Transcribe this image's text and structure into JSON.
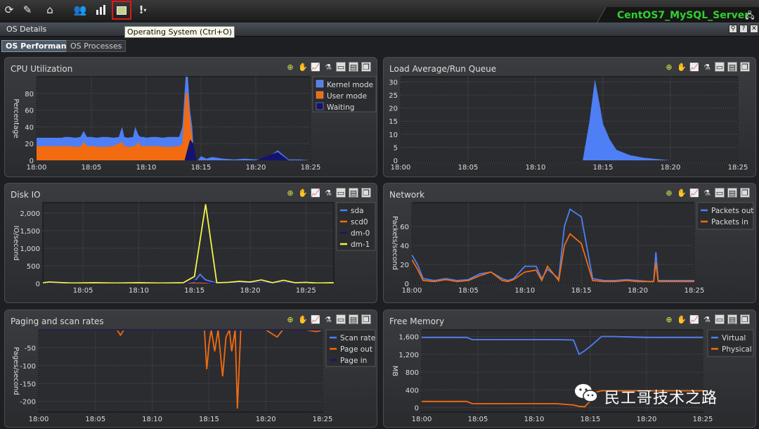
{
  "app": {
    "server_name": "CentOS7_MySQL_Server",
    "tooltip": "Operating System (Ctrl+O)",
    "window_title": "OS Details",
    "tabs": [
      {
        "label": "OS Performance",
        "active": true
      },
      {
        "label": "OS Processes",
        "active": false
      }
    ],
    "toolbar_icons": [
      "refresh-icon",
      "settings-icon",
      "home-icon",
      "users-icon",
      "bar-chart-icon",
      "operating-system-icon",
      "alert-icon"
    ]
  },
  "watermark": "民工哥技术之路",
  "colors": {
    "blue": "#4f7ff5",
    "orange": "#f26b10",
    "navy": "#14146e",
    "yellow": "#f3f34a",
    "plot_bg": "#2b2c2f",
    "grid": "#55575c"
  },
  "chart_data": [
    {
      "id": "cpu",
      "title": "CPU Utilization",
      "type": "area",
      "ylabel": "Percentage",
      "ylim": [
        0,
        100
      ],
      "yticks": [
        "0",
        "20",
        "40",
        "60",
        "80"
      ],
      "yticks_values": [
        0,
        20,
        40,
        60,
        80
      ],
      "x_labels": [
        "18:00",
        "18:05",
        "18:10",
        "18:15",
        "18:20",
        "18:25"
      ],
      "x_range": [
        0,
        25
      ],
      "legend_placement": "top-right",
      "series": [
        {
          "name": "Kernel mode",
          "color": "#4f7ff5",
          "x": [
            0,
            2,
            2.3,
            2.6,
            3,
            3.5,
            4,
            4.3,
            4.6,
            5,
            5.5,
            6,
            6.5,
            7,
            7.5,
            7.8,
            8,
            8.3,
            8.8,
            9,
            9.3,
            9.5,
            9.8,
            10,
            10.5,
            11,
            11.5,
            12,
            12.5,
            13,
            13.3,
            13.6,
            13.8,
            14,
            14.2,
            14.4,
            14.7,
            15,
            15.5,
            16,
            17,
            18,
            19,
            20,
            21,
            22,
            23,
            24,
            25
          ],
          "values": [
            27,
            27,
            27,
            28,
            28,
            27,
            28,
            35,
            28,
            28,
            27,
            28,
            28,
            27,
            28,
            40,
            28,
            27,
            28,
            40,
            30,
            28,
            28,
            27,
            28,
            28,
            27,
            28,
            28,
            28,
            40,
            100,
            100,
            60,
            40,
            0,
            0,
            5,
            2,
            4,
            2,
            1,
            2,
            1,
            3,
            12,
            1,
            1,
            0
          ]
        },
        {
          "name": "User mode",
          "color": "#f26b10",
          "x": [
            0,
            2,
            3,
            4,
            4.3,
            4.6,
            5,
            6,
            7,
            7.8,
            8,
            8.5,
            9,
            9.3,
            9.5,
            10,
            11,
            12,
            13,
            13.3,
            13.6,
            13.8,
            14,
            14.2,
            14.4,
            15,
            25
          ],
          "values": [
            17,
            17,
            17,
            16,
            22,
            17,
            17,
            16,
            17,
            22,
            17,
            16,
            17,
            22,
            17,
            17,
            17,
            16,
            17,
            20,
            80,
            80,
            50,
            25,
            0,
            0,
            0
          ]
        },
        {
          "name": "Waiting",
          "color": "#14146e",
          "x": [
            0,
            13.5,
            14,
            14.3,
            14.6,
            15,
            20,
            22,
            23,
            25
          ],
          "values": [
            0,
            0,
            25,
            20,
            0,
            0,
            0,
            10,
            0,
            0
          ]
        }
      ]
    },
    {
      "id": "load",
      "title": "Load Average/Run Queue",
      "type": "area",
      "ylabel": "",
      "ylim": [
        0,
        32
      ],
      "yticks": [
        "0",
        "5",
        "10",
        "15",
        "20",
        "25",
        "30"
      ],
      "yticks_values": [
        0,
        5,
        10,
        15,
        20,
        25,
        30
      ],
      "x_labels": [
        "18:00",
        "18:05",
        "18:10",
        "18:15",
        "18:20",
        "18:25"
      ],
      "x_range": [
        0,
        25
      ],
      "series": [
        {
          "name": "",
          "color": "#4f7ff5",
          "x": [
            0,
            13.5,
            14,
            14.4,
            14.8,
            15,
            15.5,
            16,
            17,
            18,
            19,
            20,
            25
          ],
          "values": [
            0,
            0,
            15,
            31,
            20,
            14,
            8,
            4,
            2,
            1,
            0.5,
            0,
            0
          ]
        }
      ]
    },
    {
      "id": "disk",
      "title": "Disk IO",
      "type": "line",
      "ylabel": "IO/second",
      "ylim": [
        0,
        2300
      ],
      "yticks": [
        "0",
        "500",
        "1,000",
        "1,500",
        "2,000"
      ],
      "yticks_values": [
        0,
        500,
        1000,
        1500,
        2000
      ],
      "x_labels": [
        "18:05",
        "18:10",
        "18:15",
        "18:20",
        "18:25"
      ],
      "x_labels_values": [
        5,
        10,
        15,
        20,
        25
      ],
      "x_range": [
        1.4,
        27.5
      ],
      "legend_placement": "top-right",
      "series": [
        {
          "name": "sda",
          "color": "#4f7ff5",
          "x": [
            1.4,
            14,
            15,
            15.5,
            16,
            17,
            27.5
          ],
          "values": [
            10,
            10,
            50,
            260,
            100,
            10,
            10
          ]
        },
        {
          "name": "scd0",
          "color": "#f26b10",
          "x": [
            1.4,
            27.5
          ],
          "values": [
            0,
            0
          ]
        },
        {
          "name": "dm-0",
          "color": "#14146e",
          "x": [
            1.4,
            14,
            15.5,
            16,
            17,
            27.5
          ],
          "values": [
            0,
            0,
            100,
            40,
            0,
            0
          ]
        },
        {
          "name": "dm-1",
          "color": "#f3f34a",
          "x": [
            1.4,
            2,
            4,
            6,
            8,
            10,
            12,
            14,
            15,
            16,
            17,
            18,
            19,
            20,
            21,
            22,
            23,
            24,
            25,
            26,
            27.5
          ],
          "values": [
            20,
            40,
            10,
            20,
            10,
            20,
            10,
            20,
            200,
            2250,
            20,
            30,
            60,
            40,
            100,
            20,
            90,
            20,
            30,
            10,
            20
          ]
        }
      ]
    },
    {
      "id": "network",
      "title": "Network",
      "type": "line",
      "ylabel": "Packets/second",
      "ylim": [
        0,
        85
      ],
      "yticks": [
        "0",
        "20",
        "40",
        "60"
      ],
      "yticks_values": [
        0,
        20,
        40,
        60
      ],
      "x_labels": [
        "18:00",
        "18:05",
        "18:10",
        "18:15",
        "18:20",
        "18:25"
      ],
      "x_range": [
        0,
        25
      ],
      "legend_placement": "top-right",
      "series": [
        {
          "name": "Packets out",
          "color": "#4f7ff5",
          "x": [
            0,
            0.5,
            1,
            2,
            3,
            4,
            5,
            6,
            7,
            8,
            8.5,
            9,
            10,
            11,
            11.5,
            12,
            13,
            13.5,
            14,
            15,
            16,
            17,
            18,
            19,
            20,
            21,
            21.4,
            21.6,
            21.8,
            22,
            23,
            24,
            25
          ],
          "values": [
            30,
            20,
            5,
            3,
            5,
            3,
            4,
            10,
            12,
            5,
            3,
            5,
            18,
            18,
            5,
            15,
            5,
            60,
            78,
            70,
            5,
            3,
            3,
            4,
            3,
            2,
            2,
            33,
            3,
            3,
            3,
            3,
            3
          ]
        },
        {
          "name": "Packets in",
          "color": "#f26b10",
          "x": [
            0,
            0.5,
            1,
            2,
            3,
            4,
            5,
            6,
            7,
            8,
            8.5,
            9,
            10,
            11,
            11.5,
            12,
            13,
            13.5,
            14,
            15,
            16,
            17,
            18,
            19,
            20,
            21,
            21.4,
            21.6,
            21.8,
            22,
            23,
            24,
            25
          ],
          "values": [
            25,
            15,
            3,
            2,
            4,
            2,
            3,
            8,
            12,
            3,
            2,
            4,
            12,
            14,
            3,
            18,
            3,
            40,
            52,
            42,
            3,
            2,
            2,
            3,
            2,
            2,
            2,
            22,
            2,
            2,
            2,
            2,
            2
          ]
        }
      ]
    },
    {
      "id": "paging",
      "title": "Paging and scan rates",
      "type": "line",
      "ylabel": "Pages/second",
      "ylim": [
        -230,
        0
      ],
      "yticks": [
        "-50",
        "-100",
        "-150",
        "-200"
      ],
      "yticks_values": [
        -50,
        -100,
        -150,
        -200
      ],
      "x_labels": [
        "18:00",
        "18:05",
        "18:10",
        "18:15",
        "18:20",
        "18:25"
      ],
      "x_range": [
        0,
        25
      ],
      "legend_placement": "top-right",
      "series": [
        {
          "name": "Scan rate",
          "color": "#4f7ff5",
          "x": [
            0,
            25
          ],
          "values": [
            0,
            0
          ]
        },
        {
          "name": "Page out",
          "color": "#f26b10",
          "x": [
            0,
            6.9,
            7.2,
            7.5,
            8,
            14.6,
            14.8,
            15,
            15.2,
            15.5,
            15.8,
            16.2,
            16.5,
            16.8,
            17,
            17.3,
            17.5,
            17.8,
            18,
            20,
            20.5,
            21,
            21.5,
            22,
            23.5,
            24.5,
            25
          ],
          "values": [
            0,
            0,
            -15,
            0,
            0,
            0,
            -110,
            -40,
            0,
            -60,
            0,
            -130,
            -20,
            0,
            -60,
            0,
            -220,
            0,
            0,
            0,
            -10,
            -20,
            0,
            0,
            0,
            -5,
            0
          ]
        },
        {
          "name": "Page in",
          "color": "#14146e",
          "x": [
            0,
            25
          ],
          "values": [
            0,
            0
          ]
        }
      ]
    },
    {
      "id": "memory",
      "title": "Free Memory",
      "type": "line",
      "ylabel": "MB",
      "ylim": [
        -100,
        1750
      ],
      "yticks": [
        "0",
        "400",
        "800",
        "1,200",
        "1,600"
      ],
      "yticks_values": [
        0,
        400,
        800,
        1200,
        1600
      ],
      "x_labels": [
        "18:00",
        "18:05",
        "18:10",
        "18:15",
        "18:20",
        "18:25"
      ],
      "x_range": [
        0,
        25
      ],
      "legend_placement": "top-right",
      "series": [
        {
          "name": "Virtual",
          "color": "#4f7ff5",
          "x": [
            0,
            4,
            4.5,
            12,
            13.5,
            14,
            14.5,
            15,
            16,
            17,
            20,
            25
          ],
          "values": [
            1580,
            1580,
            1530,
            1530,
            1520,
            1200,
            1280,
            1380,
            1600,
            1600,
            1580,
            1580
          ]
        },
        {
          "name": "Physical",
          "color": "#f26b10",
          "x": [
            0,
            4,
            4.5,
            12,
            13.5,
            14,
            14.5,
            15,
            15.5,
            16,
            25
          ],
          "values": [
            140,
            140,
            90,
            90,
            60,
            30,
            20,
            150,
            350,
            380,
            380
          ]
        }
      ]
    }
  ]
}
